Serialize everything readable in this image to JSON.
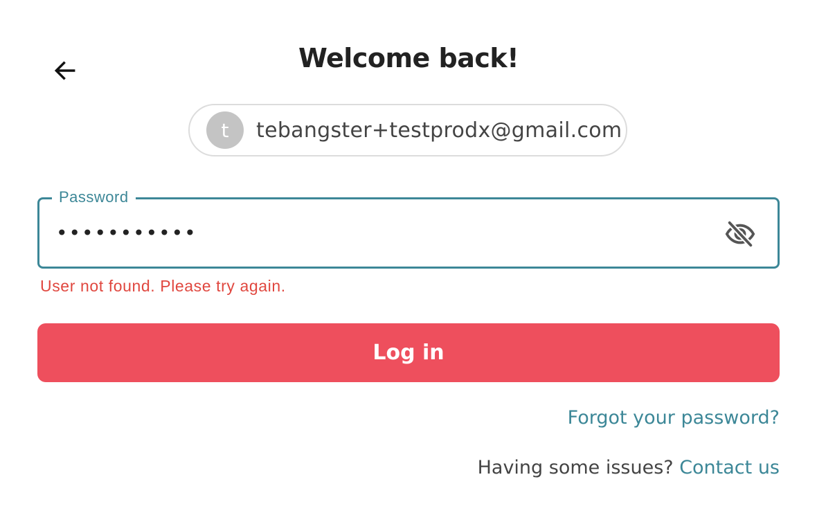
{
  "header": {
    "title": "Welcome back!",
    "back_icon": "arrow-left-icon"
  },
  "account": {
    "avatar_initial": "t",
    "email": "tebangster+testprodx@gmail.com"
  },
  "password": {
    "label": "Password",
    "value": "•••••••••••",
    "visibility_icon": "eye-off-icon",
    "error": "User not found. Please try again."
  },
  "actions": {
    "login_label": "Log in",
    "forgot_label": "Forgot your password?",
    "help_text": "Having some issues?",
    "contact_label": "Contact us"
  },
  "colors": {
    "accent": "#3c8797",
    "primary_button": "#ee4f5d",
    "error": "#e0473f",
    "avatar_bg": "#c4c4c4"
  }
}
